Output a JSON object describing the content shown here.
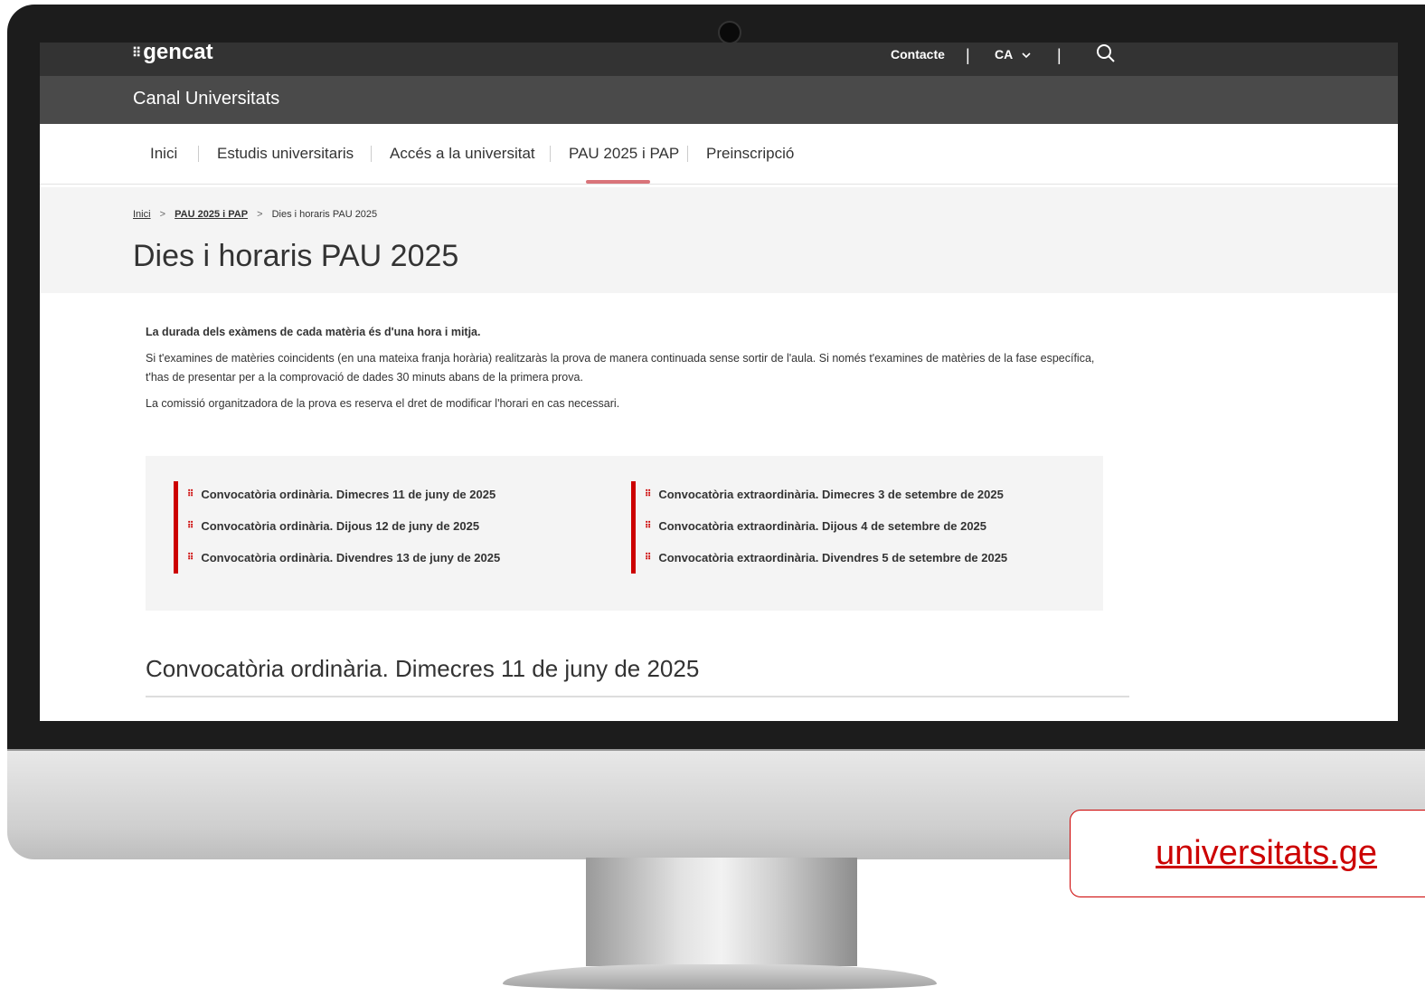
{
  "header": {
    "logo": "gencat",
    "logo_mark": "⠿",
    "contact": "Contacte",
    "language": "CA",
    "separator": "|",
    "site_title": "Canal Universitats"
  },
  "nav": {
    "items": [
      {
        "label": "Inici"
      },
      {
        "label": "Estudis universitaris"
      },
      {
        "label": "Accés a la universitat"
      },
      {
        "label": "PAU 2025 i PAP",
        "active": true
      },
      {
        "label": "Preinscripció"
      }
    ]
  },
  "breadcrumb": {
    "home": "Inici",
    "parent": "PAU 2025 i PAP",
    "current": "Dies i horaris PAU 2025",
    "separator": ">"
  },
  "page": {
    "title": "Dies i horaris PAU 2025"
  },
  "intro": {
    "lead": "La durada dels exàmens de cada matèria és d'una hora i mitja.",
    "p1": "Si t'examines de matèries coincidents (en una mateixa franja horària) realitzaràs la prova de manera continuada sense sortir de l'aula. Si només t'examines de matèries de la fase específica, t'has de presentar per a la comprovació de dades 30 minuts abans de la primera prova.",
    "p2": "La comissió organitzadora de la prova es reserva el dret de modificar l'horari en cas necessari."
  },
  "index": {
    "ordinary": [
      "Convocatòria ordinària. Dimecres 11 de juny de 2025",
      "Convocatòria ordinària. Dijous 12 de juny de 2025",
      "Convocatòria ordinària. Divendres 13 de juny de 2025"
    ],
    "extraordinary": [
      "Convocatòria extraordinària. Dimecres 3 de setembre de 2025",
      "Convocatòria extraordinària. Dijous 4 de setembre de 2025",
      "Convocatòria extraordinària. Divendres 5 de setembre de 2025"
    ]
  },
  "section": {
    "title": "Convocatòria ordinària. Dimecres 11 de juny de 2025"
  },
  "promo": {
    "url_text": "universitats.ge"
  },
  "colors": {
    "accent": "#cc0000",
    "nav_active": "#d9747a",
    "topbar": "#333333",
    "sitebar": "#4a4a4a"
  }
}
